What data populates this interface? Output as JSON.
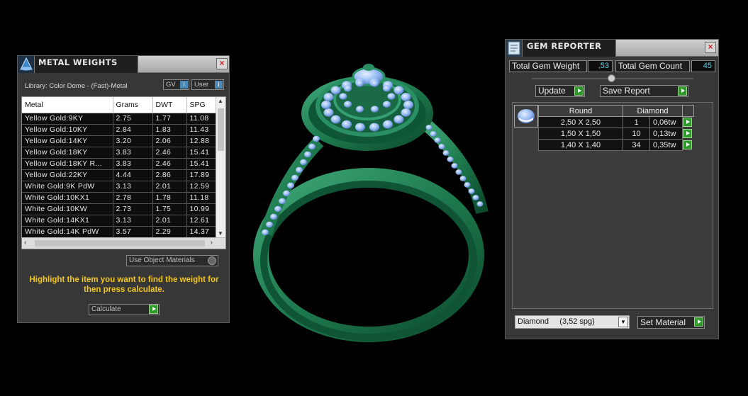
{
  "metal_panel": {
    "title": "METAL WEIGHTS",
    "library": "Library: Color Dome - (Fast)-Metal",
    "gv_label": "GV",
    "user_label": "User",
    "columns": [
      "Metal",
      "Grams",
      "DWT",
      "SPG"
    ],
    "rows": [
      [
        "Yellow Gold:9KY",
        "2.75",
        "1.77",
        "11.08"
      ],
      [
        "Yellow Gold:10KY",
        "2.84",
        "1.83",
        "11.43"
      ],
      [
        "Yellow Gold:14KY",
        "3.20",
        "2.06",
        "12.88"
      ],
      [
        "Yellow Gold:18KY",
        "3.83",
        "2.46",
        "15.41"
      ],
      [
        "Yellow Gold:18KY R...",
        "3.83",
        "2.46",
        "15.41"
      ],
      [
        "Yellow Gold:22KY",
        "4.44",
        "2.86",
        "17.89"
      ],
      [
        "White Gold:9K PdW",
        "3.13",
        "2.01",
        "12.59"
      ],
      [
        "White Gold:10KX1",
        "2.78",
        "1.78",
        "11.18"
      ],
      [
        "White Gold:10KW",
        "2.73",
        "1.75",
        "10.99"
      ],
      [
        "White Gold:14KX1",
        "3.13",
        "2.01",
        "12.61"
      ],
      [
        "White Gold:14K PdW",
        "3.57",
        "2.29",
        "14.37"
      ]
    ],
    "use_object_materials": "Use Object Materials",
    "hint": "Highlight the item you want to find the weight for then press calculate.",
    "calculate_label": "Calculate"
  },
  "gem_panel": {
    "title": "GEM REPORTER",
    "total_weight_label": "Total Gem Weight",
    "total_weight_value": ",53",
    "total_count_label": "Total Gem Count",
    "total_count_value": "45",
    "update_label": "Update",
    "save_report_label": "Save Report",
    "headers": [
      "Round",
      "Diamond"
    ],
    "rows": [
      [
        "2,50 X 2,50",
        "1",
        "0,06tw"
      ],
      [
        "1,50 X 1,50",
        "10",
        "0,13tw"
      ],
      [
        "1,40 X 1,40",
        "34",
        "0,35tw"
      ]
    ],
    "material_value": "Diamond     (3,52 spg)",
    "set_material_label": "Set Material"
  },
  "colors": {
    "ring_metal": "#1e7a4e",
    "gem": "#8fb6f0",
    "accent_green": "#2f9a2a",
    "hint_yellow": "#f2c61f"
  }
}
